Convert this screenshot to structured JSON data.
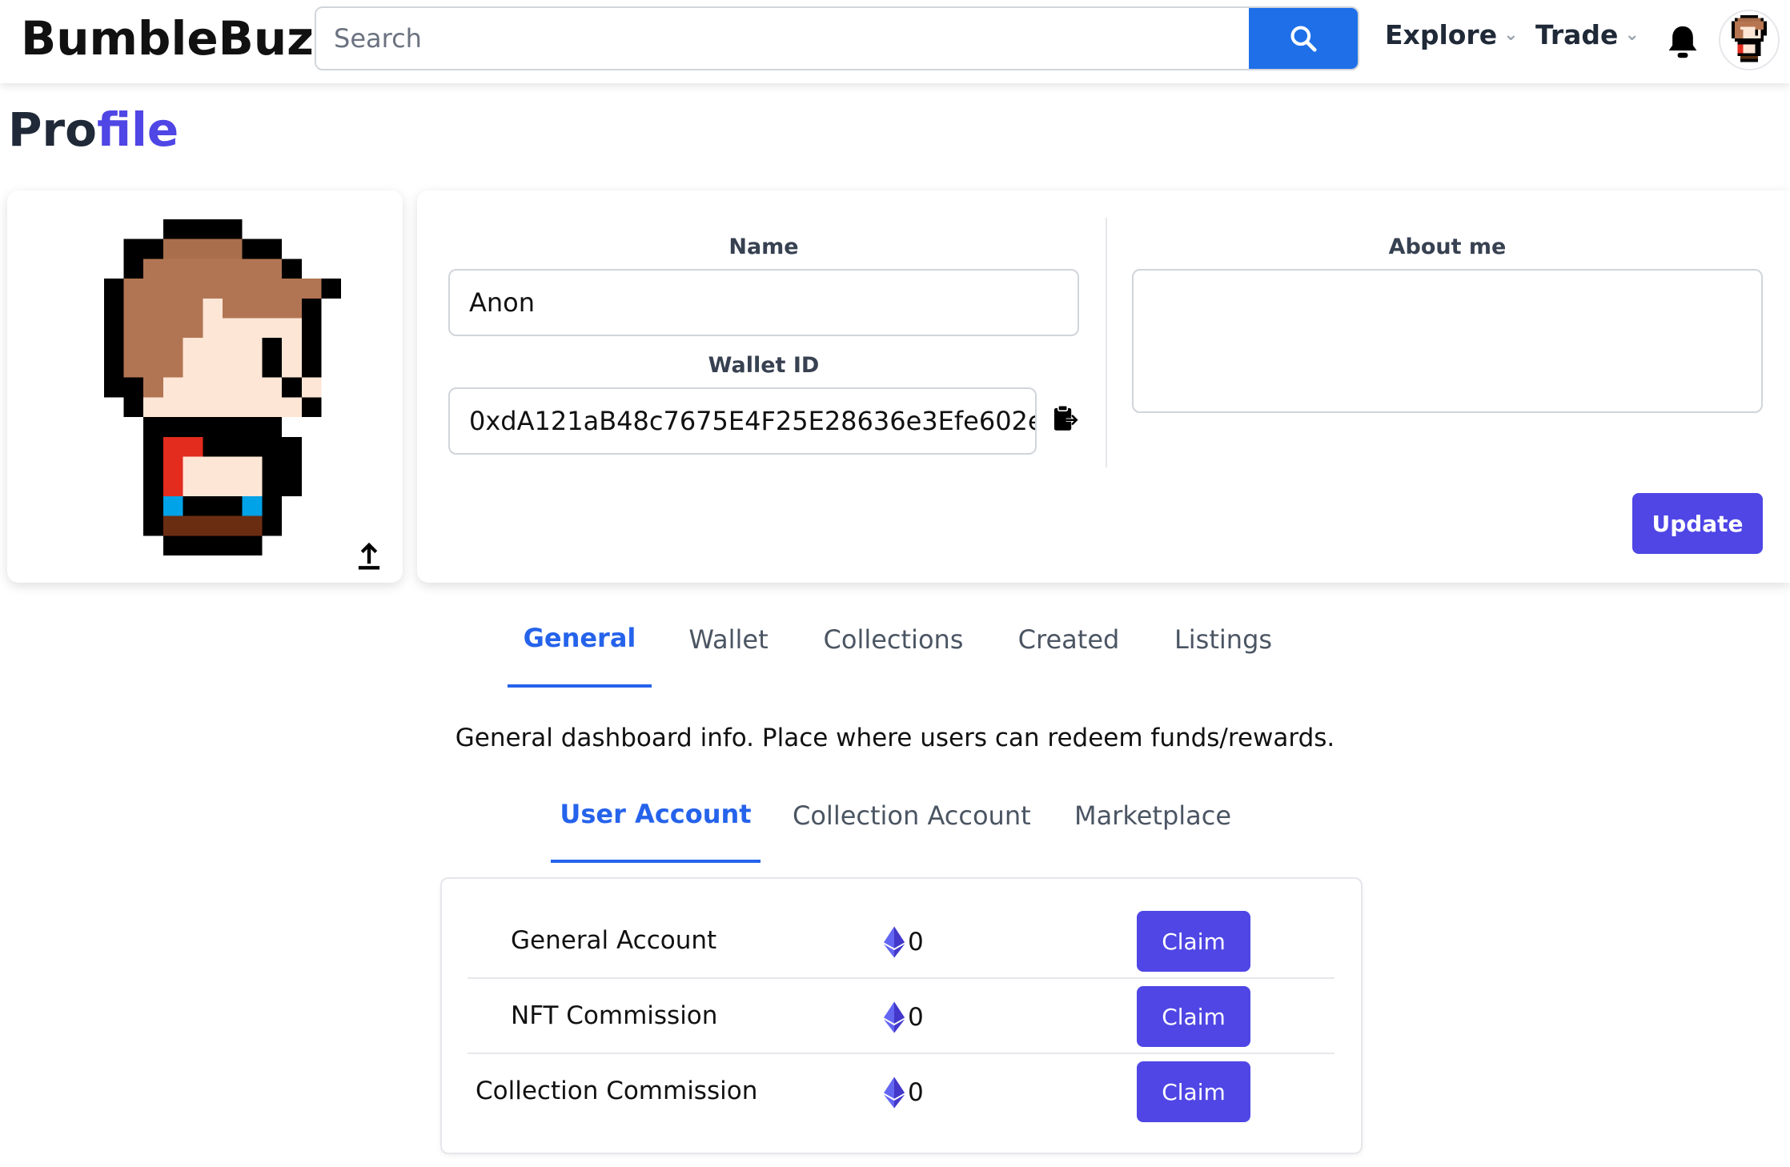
{
  "header": {
    "brand": "BumbleBuzz",
    "search_placeholder": "Search",
    "nav": [
      {
        "label": "Explore"
      },
      {
        "label": "Trade"
      }
    ]
  },
  "page": {
    "title_part1": "Pro",
    "title_part2": "file"
  },
  "profile": {
    "name_label": "Name",
    "name_value": "Anon",
    "wallet_label": "Wallet ID",
    "wallet_value": "0xdA121aB48c7675E4F25E28636e3Efe602e...",
    "about_label": "About me",
    "about_value": "",
    "update_label": "Update"
  },
  "tabs": [
    {
      "label": "General",
      "active": true
    },
    {
      "label": "Wallet",
      "active": false
    },
    {
      "label": "Collections",
      "active": false
    },
    {
      "label": "Created",
      "active": false
    },
    {
      "label": "Listings",
      "active": false
    }
  ],
  "general": {
    "description": "General dashboard info. Place where users can redeem funds/rewards.",
    "subtabs": [
      {
        "label": "User Account",
        "active": true
      },
      {
        "label": "Collection Account",
        "active": false
      },
      {
        "label": "Marketplace",
        "active": false
      }
    ],
    "rows": [
      {
        "label": "General Account",
        "value": "0",
        "action": "Claim"
      },
      {
        "label": "NFT Commission",
        "value": "0",
        "action": "Claim"
      },
      {
        "label": "Collection Commission",
        "value": "0",
        "action": "Claim"
      }
    ]
  },
  "colors": {
    "accent": "#4f46e5",
    "link_blue": "#2563eb",
    "search_blue": "#1e6fe8"
  }
}
